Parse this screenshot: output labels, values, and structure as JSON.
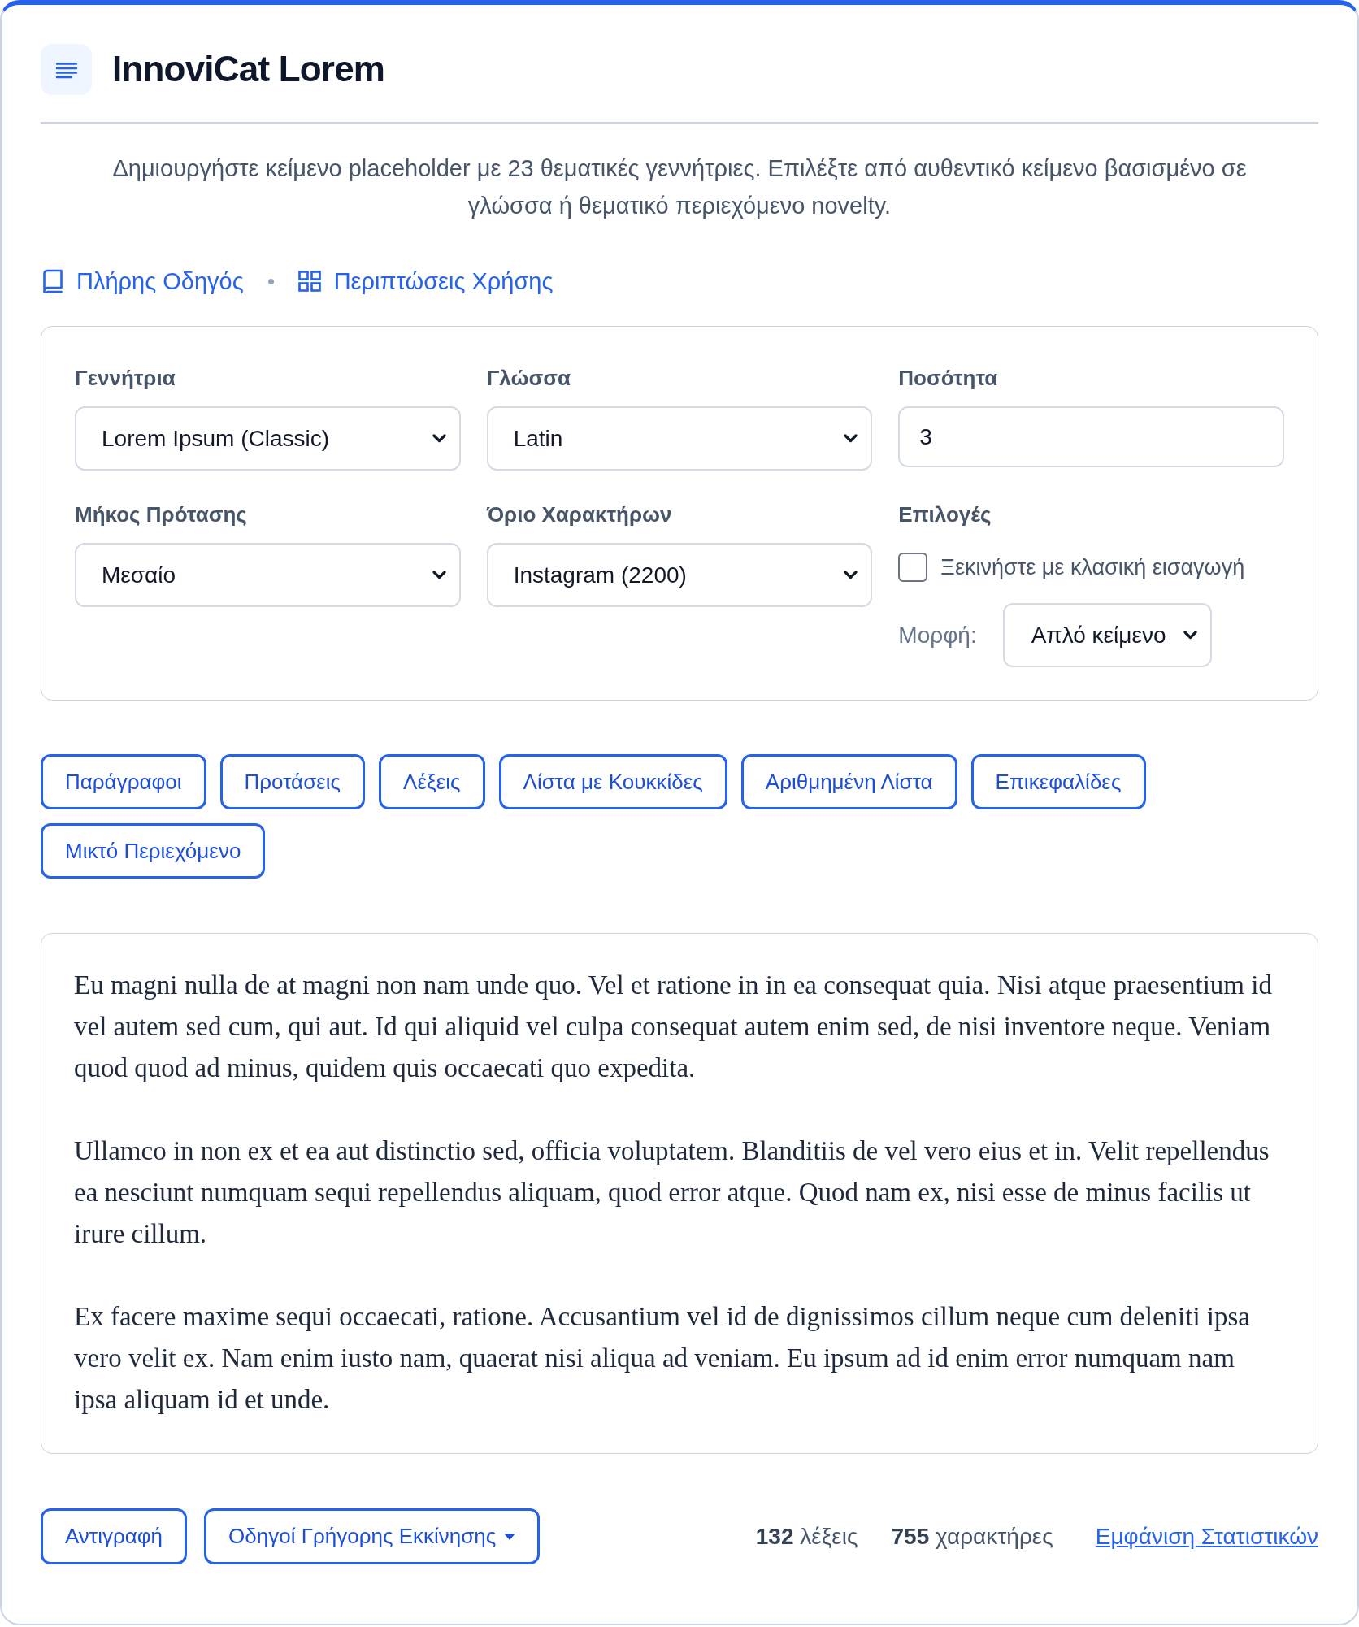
{
  "header": {
    "title": "InnoviCat Lorem",
    "description": "Δημιουργήστε κείμενο placeholder με 23 θεματικές γεννήτριες. Επιλέξτε από αυθεντικό κείμενο βασισμένο σε γλώσσα ή θεματικό περιεχόμενο novelty."
  },
  "links": [
    {
      "kind": "book",
      "label": "Πλήρης Οδηγός"
    },
    {
      "kind": "grid",
      "label": "Περιπτώσεις Χρήσης"
    }
  ],
  "settings": {
    "fields": [
      {
        "kind": "select",
        "label": "Γεννήτρια",
        "value": "Lorem Ipsum (Classic)"
      },
      {
        "kind": "select",
        "label": "Γλώσσα",
        "value": "Latin"
      },
      {
        "kind": "number",
        "label": "Ποσότητα",
        "value": "3"
      },
      {
        "kind": "select",
        "label": "Μήκος Πρότασης",
        "value": "Μεσαίο"
      },
      {
        "kind": "select",
        "label": "Όριο Χαρακτήρων",
        "value": "Instagram (2200)"
      },
      {
        "kind": "options",
        "label": "Επιλογές",
        "checkbox": {
          "label": "Ξεκινήστε με κλασική εισαγωγή",
          "checked": false
        },
        "format": {
          "label": "Μορφή:",
          "value": "Απλό κείμενο"
        }
      }
    ]
  },
  "content_types": [
    "Παράγραφοι",
    "Προτάσεις",
    "Λέξεις",
    "Λίστα με Κουκκίδες",
    "Αριθμημένη Λίστα",
    "Επικεφαλίδες",
    "Μικτό Περιεχόμενο"
  ],
  "output": {
    "paragraphs": [
      "Eu magni nulla de at magni non nam unde quo. Vel et ratione in in ea consequat quia. Nisi atque praesentium id vel autem sed cum, qui aut. Id qui aliquid vel culpa consequat autem enim sed, de nisi inventore neque. Veniam quod quod ad minus, quidem quis occaecati quo expedita.",
      "Ullamco in non ex et ea aut distinctio sed, officia voluptatem. Blanditiis de vel vero eius et in. Velit repellendus ea nesciunt numquam sequi repellendus aliquam, quod error atque. Quod nam ex, nisi esse de minus facilis ut irure cillum.",
      "Ex facere maxime sequi occaecati, ratione. Accusantium vel id de dignissimos cillum neque cum deleniti ipsa vero velit ex. Nam enim iusto nam, quaerat nisi aliqua ad veniam. Eu ipsum ad id enim error numquam nam ipsa aliquam id et unde."
    ]
  },
  "footer": {
    "actions": [
      {
        "kind": "button",
        "label": "Αντιγραφή"
      },
      {
        "kind": "dropdown",
        "label": "Οδηγοί Γρήγορης Εκκίνησης"
      }
    ],
    "stats": [
      "**132** λέξεις",
      "**755** χαρακτήρες"
    ],
    "stats_link": "Εμφάνιση Στατιστικών"
  }
}
